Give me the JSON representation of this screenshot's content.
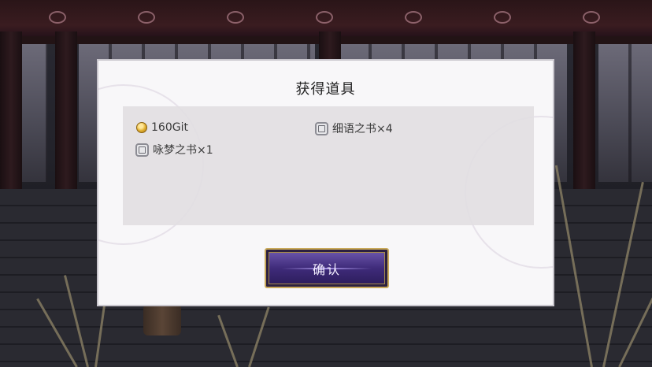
{
  "dialog": {
    "title": "获得道具",
    "items": [
      {
        "icon": "coin-icon",
        "label": "160Git"
      },
      {
        "icon": "book-icon",
        "label": "细语之书×4"
      },
      {
        "icon": "book-icon",
        "label": "咏梦之书×1"
      }
    ],
    "confirm_label": "确认"
  },
  "colors": {
    "dialog_bg": "#f8f7f9",
    "items_panel_bg": "#e2dee2",
    "button_gold": "#c9a95a",
    "button_purple": "#3f2b7a"
  }
}
